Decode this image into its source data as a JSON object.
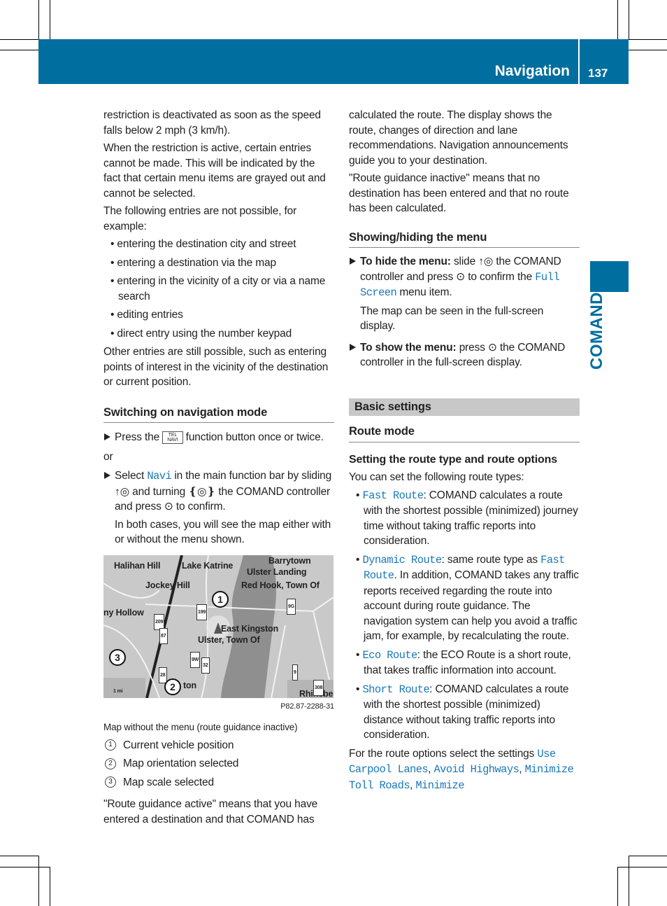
{
  "header": {
    "section": "Navigation",
    "page": "137",
    "side_tab": "COMAND",
    "color": "#006e9e"
  },
  "left": {
    "p1": [
      {
        "t": "restriction is deactivated as soon as the speed falls below 2 mph (3 km/h)."
      }
    ],
    "p2": [
      {
        "t": "When the restriction is active, certain entries cannot be made. This will be indicated by the fact that certain menu items are grayed out and cannot be selected."
      }
    ],
    "p3": [
      {
        "t": "The following entries are not possible, for example:"
      }
    ],
    "bullets": [
      "entering the destination city and street",
      "entering a destination via the map",
      "entering in the vicinity of a city or via a name search",
      "editing entries",
      "direct entry using the number keypad"
    ],
    "p4": [
      {
        "t": "Other entries are still possible, such as entering points of interest in the vicinity of the destination or current position."
      }
    ],
    "h_switch": "Switching on navigation mode",
    "step1": [
      {
        "t": "Press the "
      },
      {
        "key": true
      },
      {
        "t": " function button once or twice."
      }
    ],
    "key_top": "TEL",
    "key_bottom": "NAVI",
    "or": "or",
    "step2": [
      {
        "t": "Select "
      },
      {
        "t": "Navi",
        "c": 1
      },
      {
        "t": " in the main function bar by sliding ↑◎ and turning ❴◎❵ the COMAND controller and press ⊙ to confirm."
      }
    ],
    "step2b": "In both cases, you will see the map either with or without the menu shown.",
    "map": {
      "labels": [
        "Halihan Hill",
        "Lake Katrine",
        "Barrytown",
        "Ulster Landing",
        "Jockey Hill",
        "Red Hook, Town Of",
        "ny Hollow",
        "East Kingston",
        "Ulster, Town Of",
        "K",
        "ton",
        "1 mi",
        "Rhinebec"
      ],
      "shields": [
        "199",
        "209",
        "87",
        "9W",
        "32",
        "28",
        "9",
        "9G",
        "308"
      ],
      "callouts": [
        "1",
        "2",
        "3"
      ],
      "ref": "P82.87-2288-31"
    },
    "caption": "Map without the menu (route guidance inactive)",
    "legend": [
      {
        "n": "1",
        "t": "Current vehicle position"
      },
      {
        "n": "2",
        "t": "Map orientation selected"
      },
      {
        "n": "3",
        "t": "Map scale selected"
      }
    ],
    "p5": [
      {
        "t": "\"Route guidance active\" means that you have entered a destination and that COMAND has"
      }
    ]
  },
  "right": {
    "p1": [
      {
        "t": "calculated the route. The display shows the route, changes of direction and lane recommendations. Navigation announcements guide you to your destination."
      }
    ],
    "p2": [
      {
        "t": "\"Route guidance inactive\" means that no destination has been entered and that no route has been calculated."
      }
    ],
    "h_show": "Showing/hiding the menu",
    "hide": [
      {
        "t": "To hide the menu:",
        "b": 1
      },
      {
        "t": " slide ↑◎ the COMAND controller and press ⊙ to confirm the "
      },
      {
        "t": "Full Screen",
        "c": 1
      },
      {
        "t": " menu item."
      }
    ],
    "hide_b": "The map can be seen in the full-screen display.",
    "show": [
      {
        "t": "To show the menu:",
        "b": 1
      },
      {
        "t": " press ⊙ the COMAND controller in the full-screen display."
      }
    ],
    "basic": "Basic settings",
    "h_route": "Route mode",
    "h_type": "Setting the route type and route options",
    "p3": [
      {
        "t": "You can set the following route types:"
      }
    ],
    "types": [
      [
        {
          "t": "Fast Route",
          "c": 1
        },
        {
          "t": ": COMAND calculates a route with the shortest possible (minimized) journey time without taking traffic reports into consideration."
        }
      ],
      [
        {
          "t": "Dynamic Route",
          "c": 1
        },
        {
          "t": ": same route type as "
        },
        {
          "t": "Fast Route",
          "c": 1
        },
        {
          "t": ". In addition, COMAND takes any traffic reports received regarding the route into account during route guidance. The navigation system can help you avoid a traffic jam, for example, by recalculating the route."
        }
      ],
      [
        {
          "t": "Eco Route",
          "c": 1
        },
        {
          "t": ": the ECO Route is a short route, that takes traffic information into account."
        }
      ],
      [
        {
          "t": "Short Route",
          "c": 1
        },
        {
          "t": ": COMAND calculates a route with the shortest possible (minimized) distance without taking traffic reports into consideration."
        }
      ]
    ],
    "p4": [
      {
        "t": "For the route options select the settings "
      },
      {
        "t": "Use Carpool Lanes",
        "c": 1
      },
      {
        "t": ", "
      },
      {
        "t": "Avoid Highways",
        "c": 1
      },
      {
        "t": ", "
      },
      {
        "t": "Minimize Toll Roads",
        "c": 1
      },
      {
        "t": ", "
      },
      {
        "t": "Minimize",
        "c": 1
      }
    ]
  }
}
